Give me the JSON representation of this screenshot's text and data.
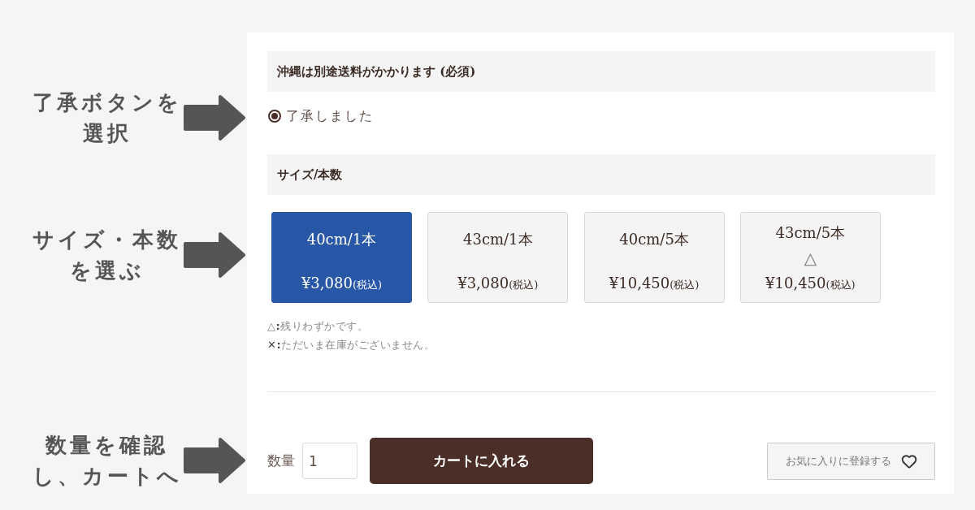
{
  "notice": {
    "annotation": [
      "了承ボタンを",
      "選択"
    ],
    "heading": "沖縄は別途送料がかかります (必須)",
    "option": {
      "label": "了承しました",
      "selected": true
    }
  },
  "size": {
    "annotation": [
      "サイズ・本数",
      "を選ぶ"
    ],
    "heading": "サイズ/本数",
    "options": [
      {
        "label": "40cm/1本",
        "price": "¥3,080",
        "tax_note": "(税込)",
        "selected": true
      },
      {
        "label": "43cm/1本",
        "price": "¥3,080",
        "tax_note": "(税込)",
        "selected": false
      },
      {
        "label": "40cm/5本",
        "price": "¥10,450",
        "tax_note": "(税込)",
        "selected": false
      },
      {
        "label": "43cm/5本",
        "stock_mark": "△",
        "price": "¥10,450",
        "tax_note": "(税込)",
        "selected": false
      }
    ],
    "legend": [
      "△**:**残りわずかです。",
      "**✕:**ただいま在庫がございません。"
    ]
  },
  "purchase": {
    "annotation": [
      "数量を確認",
      "し、カートへ"
    ],
    "quantity_label": "数量",
    "quantity": "1",
    "cart_button": "カートに入れる",
    "favorite_button": "お気に入りに登録する"
  }
}
